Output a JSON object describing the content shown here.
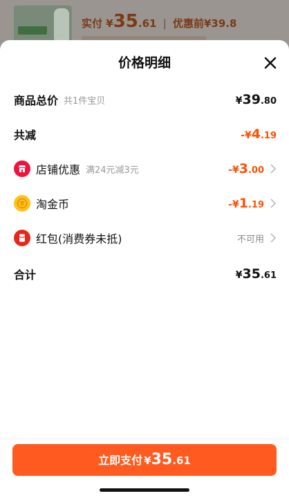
{
  "background": {
    "pay_label": "实付",
    "pay_currency": "¥",
    "pay_int": "35",
    "pay_dec": ".61",
    "separator": "|",
    "before_label": "优惠前",
    "before_value": "¥39.8"
  },
  "sheet": {
    "title": "价格明细",
    "close_icon": "close-icon"
  },
  "rows": {
    "total": {
      "label": "商品总价",
      "sub": "共1件宝贝",
      "currency": "¥",
      "int": "39",
      "dec": ".80"
    },
    "reduce": {
      "label": "共减",
      "currency": "-¥",
      "int": "4",
      "dec": ".19"
    },
    "store": {
      "label": "店铺优惠",
      "sub": "满24元减3元",
      "currency": "-¥",
      "int": "3",
      "dec": ".00",
      "icon": "store-icon"
    },
    "coins": {
      "label": "淘金币",
      "currency": "-¥",
      "int": "1",
      "dec": ".19",
      "icon": "coin-icon"
    },
    "redpacket": {
      "label": "红包(消费券未抵)",
      "status": "不可用",
      "icon": "red-packet-icon"
    },
    "sum": {
      "label": "合计",
      "currency": "¥",
      "int": "35",
      "dec": ".61"
    }
  },
  "footer": {
    "button_text": "立即支付",
    "currency": "¥",
    "int": "35",
    "dec": ".61"
  },
  "colors": {
    "accent": "#ff5000",
    "button": "#ff5a1f"
  }
}
